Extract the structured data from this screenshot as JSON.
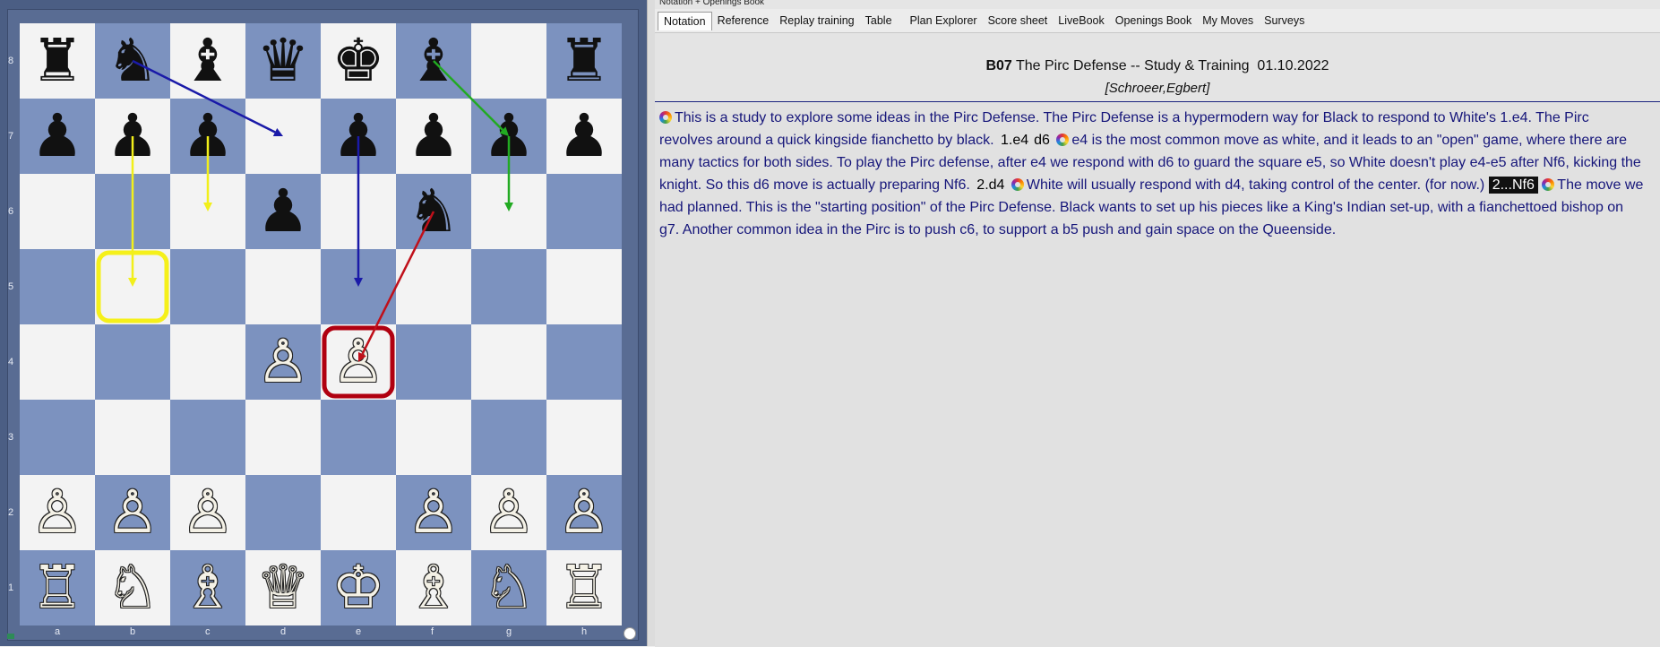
{
  "board": {
    "files": [
      "a",
      "b",
      "c",
      "d",
      "e",
      "f",
      "g",
      "h"
    ],
    "ranks": [
      "8",
      "7",
      "6",
      "5",
      "4",
      "3",
      "2",
      "1"
    ],
    "pieces": [
      {
        "sq": "a8",
        "p": "♜",
        "c": "b",
        "name": "black-rook-icon"
      },
      {
        "sq": "b8",
        "p": "♞",
        "c": "b",
        "name": "black-knight-icon"
      },
      {
        "sq": "c8",
        "p": "♝",
        "c": "b",
        "name": "black-bishop-icon"
      },
      {
        "sq": "d8",
        "p": "♛",
        "c": "b",
        "name": "black-queen-icon"
      },
      {
        "sq": "e8",
        "p": "♚",
        "c": "b",
        "name": "black-king-icon"
      },
      {
        "sq": "f8",
        "p": "♝",
        "c": "b",
        "name": "black-bishop-icon"
      },
      {
        "sq": "h8",
        "p": "♜",
        "c": "b",
        "name": "black-rook-icon"
      },
      {
        "sq": "a7",
        "p": "♟",
        "c": "b",
        "name": "black-pawn-icon"
      },
      {
        "sq": "b7",
        "p": "♟",
        "c": "b",
        "name": "black-pawn-icon"
      },
      {
        "sq": "c7",
        "p": "♟",
        "c": "b",
        "name": "black-pawn-icon"
      },
      {
        "sq": "e7",
        "p": "♟",
        "c": "b",
        "name": "black-pawn-icon"
      },
      {
        "sq": "f7",
        "p": "♟",
        "c": "b",
        "name": "black-pawn-icon"
      },
      {
        "sq": "g7",
        "p": "♟",
        "c": "b",
        "name": "black-pawn-icon"
      },
      {
        "sq": "h7",
        "p": "♟",
        "c": "b",
        "name": "black-pawn-icon"
      },
      {
        "sq": "d6",
        "p": "♟",
        "c": "b",
        "name": "black-pawn-icon"
      },
      {
        "sq": "f6",
        "p": "♞",
        "c": "b",
        "name": "black-knight-icon"
      },
      {
        "sq": "d4",
        "p": "♙",
        "c": "w",
        "name": "white-pawn-icon"
      },
      {
        "sq": "e4",
        "p": "♙",
        "c": "w",
        "name": "white-pawn-icon"
      },
      {
        "sq": "a2",
        "p": "♙",
        "c": "w",
        "name": "white-pawn-icon"
      },
      {
        "sq": "b2",
        "p": "♙",
        "c": "w",
        "name": "white-pawn-icon"
      },
      {
        "sq": "c2",
        "p": "♙",
        "c": "w",
        "name": "white-pawn-icon"
      },
      {
        "sq": "f2",
        "p": "♙",
        "c": "w",
        "name": "white-pawn-icon"
      },
      {
        "sq": "g2",
        "p": "♙",
        "c": "w",
        "name": "white-pawn-icon"
      },
      {
        "sq": "h2",
        "p": "♙",
        "c": "w",
        "name": "white-pawn-icon"
      },
      {
        "sq": "a1",
        "p": "♖",
        "c": "w",
        "name": "white-rook-icon"
      },
      {
        "sq": "b1",
        "p": "♘",
        "c": "w",
        "name": "white-knight-icon"
      },
      {
        "sq": "c1",
        "p": "♗",
        "c": "w",
        "name": "white-bishop-icon"
      },
      {
        "sq": "d1",
        "p": "♕",
        "c": "w",
        "name": "white-queen-icon"
      },
      {
        "sq": "e1",
        "p": "♔",
        "c": "w",
        "name": "white-king-icon"
      },
      {
        "sq": "f1",
        "p": "♗",
        "c": "w",
        "name": "white-bishop-icon"
      },
      {
        "sq": "g1",
        "p": "♘",
        "c": "w",
        "name": "white-knight-icon"
      },
      {
        "sq": "h1",
        "p": "♖",
        "c": "w",
        "name": "white-rook-icon"
      }
    ],
    "arrows": [
      {
        "from": "b8",
        "to": "d7",
        "color": "#1a1aa8"
      },
      {
        "from": "f8",
        "to": "g7",
        "color": "#22aa22"
      },
      {
        "from": "g7",
        "to": "g6",
        "color": "#22aa22"
      },
      {
        "from": "b7",
        "to": "b5",
        "color": "#f2ef1a"
      },
      {
        "from": "c7",
        "to": "c6",
        "color": "#f2ef1a"
      },
      {
        "from": "e7",
        "to": "e5",
        "color": "#1a1aa8"
      },
      {
        "from": "f6",
        "to": "e4",
        "color": "#c0101a"
      }
    ],
    "highlights": [
      {
        "sq": "b5",
        "color": "#f5f01a"
      },
      {
        "sq": "e4",
        "color": "#b00010"
      }
    ]
  },
  "window": {
    "title": "Notation + Openings Book"
  },
  "tabs": [
    {
      "label": "Notation",
      "active": true
    },
    {
      "label": "Reference"
    },
    {
      "label": "Replay training"
    },
    {
      "label": "Table"
    },
    {
      "label": "Plan Explorer"
    },
    {
      "label": "Score sheet"
    },
    {
      "label": "LiveBook"
    },
    {
      "label": "Openings Book"
    },
    {
      "label": "My Moves"
    },
    {
      "label": "Surveys"
    }
  ],
  "game": {
    "eco": "B07",
    "title": " The Pirc Defense -- Study & Training  01.10.2022",
    "author": "[Schroeer,Egbert]"
  },
  "notation": {
    "intro": "This is a study to explore some ideas in the Pirc Defense. The Pirc Defense is a hypermodern way for Black to respond to White's 1.e4. The Pirc revolves around a quick kingside fianchetto by black.",
    "move1": "1.e4",
    "move1b": "d6",
    "comment1": "e4 is the most common move as white, and it leads to an \"open\" game, where there are many tactics for both sides. To play the Pirc defense, after e4 we respond with d6 to guard the square e5, so White doesn't play e4-e5 after Nf6, kicking the knight. So this d6 move is actually preparing Nf6.",
    "move2": "2.d4",
    "comment2": "White will usually respond with d4, taking control of the center. (for now.)",
    "move2b": "2...Nf6",
    "comment3": "The move we had planned. This is the \"starting position\" of the Pirc Defense. Black wants to set up his pieces like a King's Indian set-up, with a fianchettoed bishop on g7. Another common idea in the Pirc is to push c6, to support a b5 push and gain space on the Queenside."
  }
}
